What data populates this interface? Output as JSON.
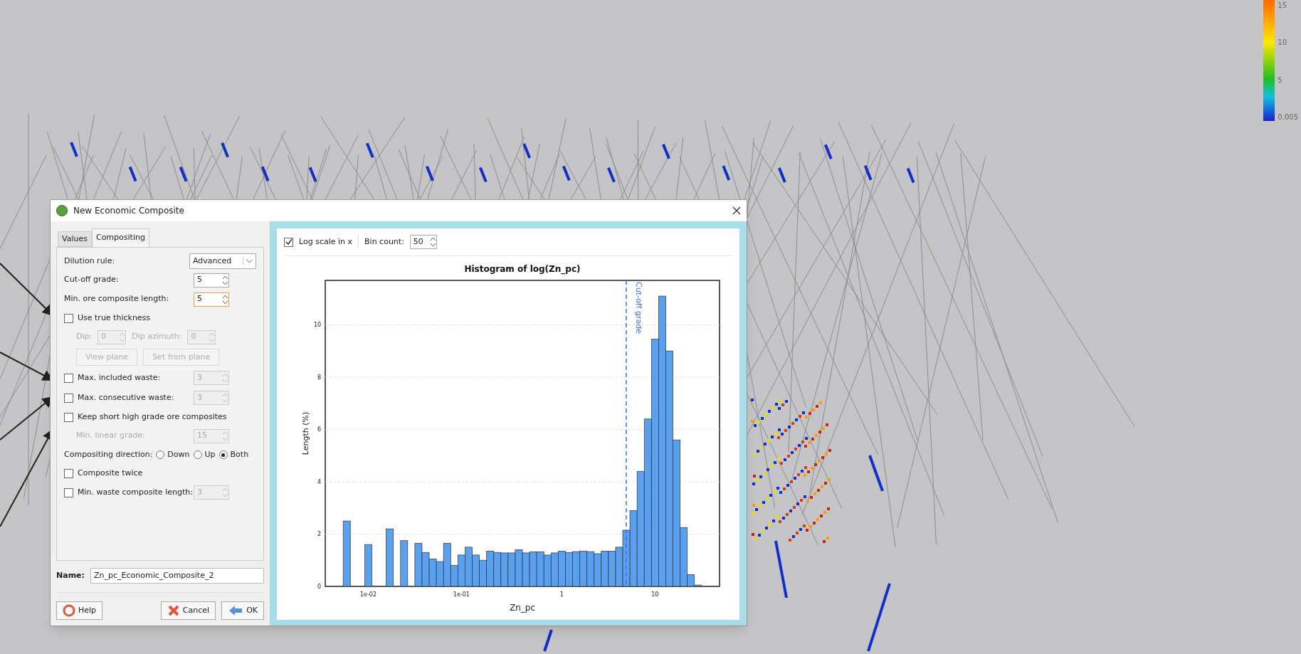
{
  "legend": {
    "labels": [
      "15",
      "10",
      "5",
      "0.005"
    ]
  },
  "dialog": {
    "title": "New Economic Composite",
    "tabs": [
      {
        "label": "Values",
        "selected": false
      },
      {
        "label": "Compositing",
        "selected": true
      }
    ],
    "rows": [
      {
        "kind": "select",
        "label": "Dilution rule:",
        "value": "Advanced"
      },
      {
        "kind": "spin",
        "label": "Cut-off grade:",
        "value": "5",
        "focused": false
      },
      {
        "kind": "spin",
        "label": "Min. ore composite length:",
        "value": "5",
        "focused": true
      },
      {
        "kind": "check",
        "label": "Use true thickness",
        "checked": false
      },
      {
        "kind": "dip",
        "disabled": true,
        "items": [
          {
            "label": "Dip:",
            "value": "0"
          },
          {
            "label": "Dip azimuth:",
            "value": "0"
          }
        ]
      },
      {
        "kind": "buttons",
        "disabled": true,
        "items": [
          "View plane",
          "Set from plane"
        ]
      },
      {
        "kind": "check_spin",
        "label": "Max. included waste:",
        "checked": false,
        "value": "3"
      },
      {
        "kind": "check_spin",
        "label": "Max. consecutive waste:",
        "checked": false,
        "value": "3"
      },
      {
        "kind": "check",
        "label": "Keep short high grade ore composites",
        "checked": false
      },
      {
        "kind": "sub_spin",
        "label": "Min. linear grade:",
        "value": "15",
        "disabled": true
      },
      {
        "kind": "radio",
        "label": "Compositing direction:",
        "options": [
          {
            "label": "Down",
            "selected": false
          },
          {
            "label": "Up",
            "selected": false
          },
          {
            "label": "Both",
            "selected": true
          }
        ]
      },
      {
        "kind": "check",
        "label": "Composite twice",
        "checked": false
      },
      {
        "kind": "check_spin",
        "label": "Min. waste composite length:",
        "checked": false,
        "value": "3"
      }
    ],
    "name": {
      "label": "Name:",
      "value": "Zn_pc_Economic_Composite_2"
    },
    "buttons": [
      {
        "kind": "help",
        "label": "Help"
      },
      {
        "kind": "cancel",
        "label": "Cancel"
      },
      {
        "kind": "ok",
        "label": "OK"
      }
    ],
    "chart_panel": {
      "log_scale": {
        "label": "Log scale in x",
        "checked": true
      },
      "bin_count": {
        "label": "Bin count:",
        "value": "50"
      },
      "chart_data": {
        "type": "bar",
        "title": "Histogram of log(Zn_pc)",
        "xlabel": "Zn_pc",
        "ylabel": "Length (%)",
        "categories": [
          null,
          null,
          null,
          "1e-02",
          null,
          null,
          null,
          null,
          null,
          null,
          null,
          null,
          null,
          null,
          null,
          null,
          "1e-01",
          null,
          null,
          null,
          null,
          null,
          null,
          null,
          null,
          null,
          null,
          null,
          null,
          null,
          "1",
          null,
          null,
          null,
          null,
          null,
          null,
          null,
          null,
          null,
          null,
          null,
          null,
          "10",
          null,
          null,
          null,
          null,
          null,
          null
        ],
        "values": [
          2.5,
          0,
          0,
          1.6,
          0,
          0,
          2.2,
          0,
          1.75,
          0,
          1.65,
          1.3,
          1.05,
          0.95,
          1.65,
          0.8,
          1.2,
          1.5,
          1.2,
          1.0,
          1.35,
          1.3,
          1.28,
          1.28,
          1.4,
          1.28,
          1.32,
          1.32,
          1.2,
          1.28,
          1.35,
          1.3,
          1.33,
          1.35,
          1.33,
          1.25,
          1.35,
          1.35,
          1.5,
          2.15,
          2.9,
          4.4,
          6.4,
          9.45,
          11.1,
          9.0,
          5.6,
          2.25,
          0.45,
          0.05
        ],
        "ylim": [
          0,
          11.7
        ],
        "grid": true,
        "yticks": [
          0,
          2,
          4,
          6,
          8,
          10
        ],
        "annotations": [
          "Cut-off grade"
        ]
      }
    }
  }
}
